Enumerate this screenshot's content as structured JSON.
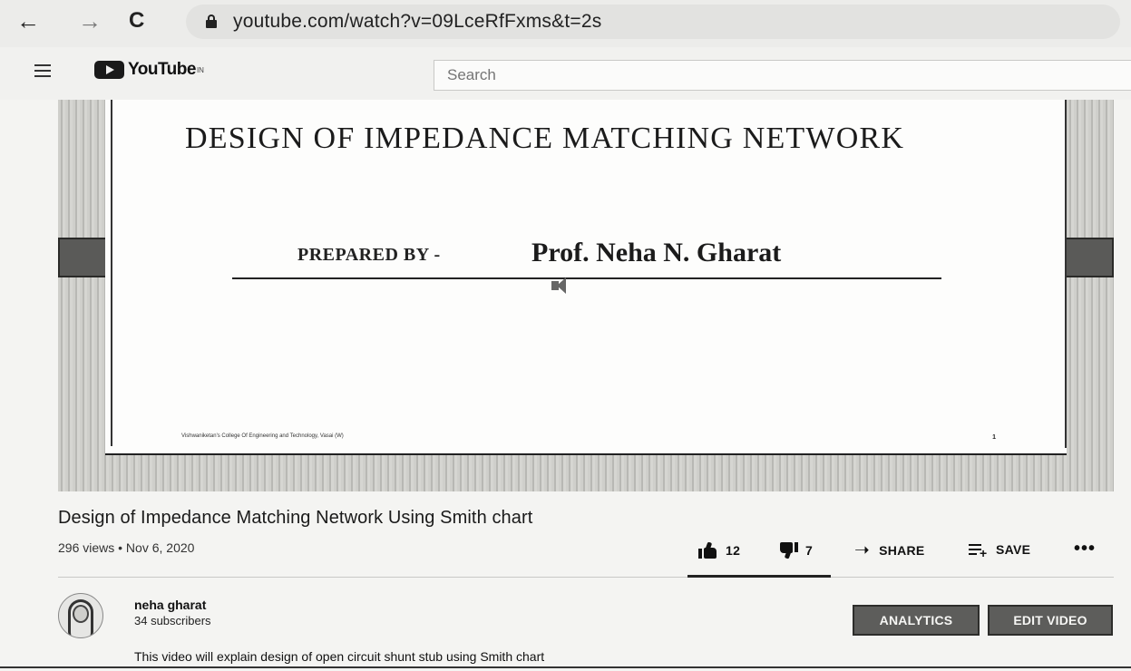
{
  "browser": {
    "back_icon": "arrow-left-icon",
    "forward_icon": "arrow-right-icon",
    "reload_icon": "reload-icon",
    "url": "youtube.com/watch?v=09LceRfFxms&t=2s"
  },
  "header": {
    "logo_text": "YouTube",
    "logo_sup": "IN",
    "search_placeholder": "Search"
  },
  "slide": {
    "title": "DESIGN OF IMPEDANCE MATCHING NETWORK",
    "prepared_by": "PREPARED BY -",
    "author": "Prof. Neha N. Gharat",
    "footer": "Vishwaniketan's College Of Engineering and Technology, Vasai (W)",
    "page_number": "1"
  },
  "video": {
    "title": "Design of Impedance Matching Network Using Smith chart",
    "meta": "296 views • Nov 6, 2020",
    "likes": "12",
    "dislikes": "7",
    "share_label": "SHARE",
    "save_label": "SAVE",
    "more_label": "•••"
  },
  "channel": {
    "name": "neha gharat",
    "subscribers": "34 subscribers",
    "analytics_label": "ANALYTICS",
    "edit_label": "EDIT VIDEO",
    "description": "This video will explain design of open circuit shunt stub using Smith chart"
  }
}
